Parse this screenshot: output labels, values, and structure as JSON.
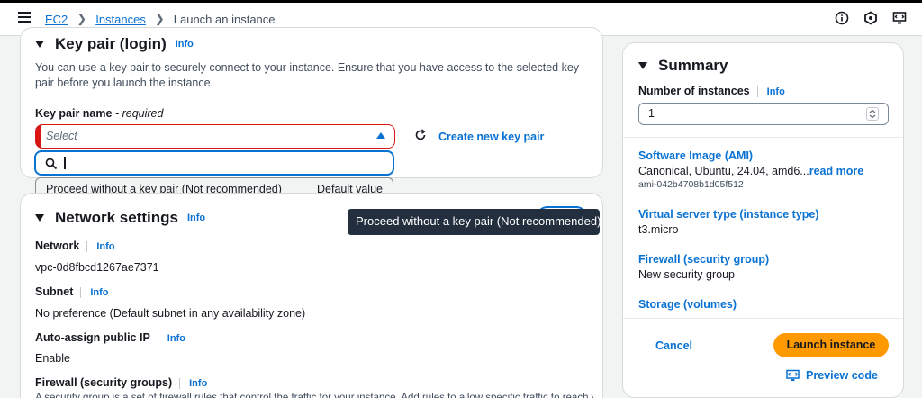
{
  "topbar": {
    "breadcrumbs": [
      {
        "label": "EC2"
      },
      {
        "label": "Instances"
      },
      {
        "label": "Launch an instance"
      }
    ],
    "icons": [
      "info-icon",
      "settings-icon",
      "preview-code-icon"
    ]
  },
  "key_pair": {
    "title": "Key pair (login)",
    "info": "Info",
    "description": "You can use a key pair to securely connect to your instance. Ensure that you have access to the selected key pair before you launch the instance.",
    "field_label": "Key pair name",
    "required": " - required",
    "placeholder": "Select",
    "create_link": "Create new key pair",
    "search_value": "",
    "dropdown_option": "Proceed without a key pair (Not recommended)",
    "dropdown_option_tag": "Default value"
  },
  "tooltip": "Proceed without a key pair (Not recommended)",
  "network": {
    "title": "Network settings",
    "info": "Info",
    "network_label": "Network",
    "network_info": "Info",
    "network_value": "vpc-0d8fbcd1267ae7371",
    "subnet_label": "Subnet",
    "subnet_info": "Info",
    "subnet_value": "No preference (Default subnet in any availability zone)",
    "public_ip_label": "Auto-assign public IP",
    "public_ip_info": "Info",
    "public_ip_value": "Enable",
    "firewall_label": "Firewall (security groups)",
    "firewall_info": "Info",
    "firewall_desc": "A security group is a set of firewall rules that control the traffic for your instance. Add rules to allow specific traffic to reach your"
  },
  "summary": {
    "title": "Summary",
    "instances_label": "Number of instances",
    "instances_info": "Info",
    "instances_value": "1",
    "ami_label": "Software Image (AMI)",
    "ami_value": "Canonical, Ubuntu, 24.04, amd6...",
    "read_more": "read more",
    "ami_id": "ami-042b4708b1d05f512",
    "type_label": "Virtual server type (instance type)",
    "type_value": "t3.micro",
    "firewall_label": "Firewall (security group)",
    "firewall_value": "New security group",
    "storage_label": "Storage (volumes)",
    "cancel": "Cancel",
    "launch": "Launch instance",
    "preview": "Preview code"
  },
  "colors": {
    "link": "#0972d3",
    "error": "#d91515",
    "primary": "#ff9900",
    "tooltip": "#232f3e"
  }
}
